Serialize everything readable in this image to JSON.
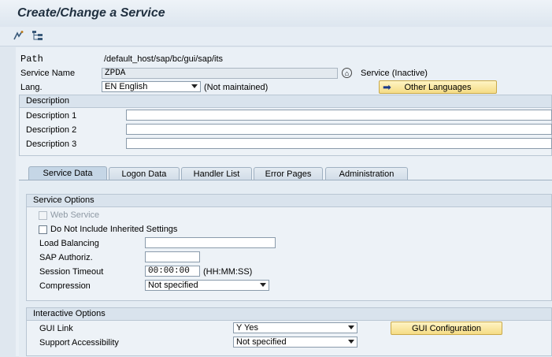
{
  "window": {
    "title": "Create/Change a Service"
  },
  "toolbar": {
    "icons": [
      "display-change-icon",
      "hierarchy-icon"
    ]
  },
  "header": {
    "path_label": "Path",
    "path_value": "/default_host/sap/bc/gui/sap/its",
    "service_name_label": "Service Name",
    "service_name_value": "ZPDA",
    "service_status": "Service (Inactive)",
    "lang_label": "Lang.",
    "lang_value": "EN English",
    "lang_note": "(Not maintained)",
    "other_languages_button": "Other Languages"
  },
  "description": {
    "title": "Description",
    "fields": [
      {
        "label": "Description 1",
        "value": ""
      },
      {
        "label": "Description 2",
        "value": ""
      },
      {
        "label": "Description 3",
        "value": ""
      }
    ]
  },
  "tabs": [
    {
      "label": "Service Data",
      "active": true
    },
    {
      "label": "Logon Data",
      "active": false
    },
    {
      "label": "Handler List",
      "active": false
    },
    {
      "label": "Error Pages",
      "active": false
    },
    {
      "label": "Administration",
      "active": false
    }
  ],
  "service_options": {
    "title": "Service Options",
    "web_service_label": "Web Service",
    "do_not_include_label": "Do Not Include Inherited Settings",
    "load_balancing_label": "Load Balancing",
    "load_balancing_value": "",
    "sap_authoriz_label": "SAP Authoriz.",
    "sap_authoriz_value": "",
    "session_timeout_label": "Session Timeout",
    "session_timeout_value": "00:00:00",
    "session_timeout_unit": "(HH:MM:SS)",
    "compression_label": "Compression",
    "compression_value": "Not specified"
  },
  "interactive_options": {
    "title": "Interactive Options",
    "gui_link_label": "GUI Link",
    "gui_link_value": "Y Yes",
    "gui_configuration_button": "GUI Configuration",
    "support_accessibility_label": "Support Accessibility",
    "support_accessibility_value": "Not specified"
  },
  "colors": {
    "accent_button": "#f5dc85",
    "panel": "#e4ecf3",
    "header_bg": "#d9e3ed"
  }
}
